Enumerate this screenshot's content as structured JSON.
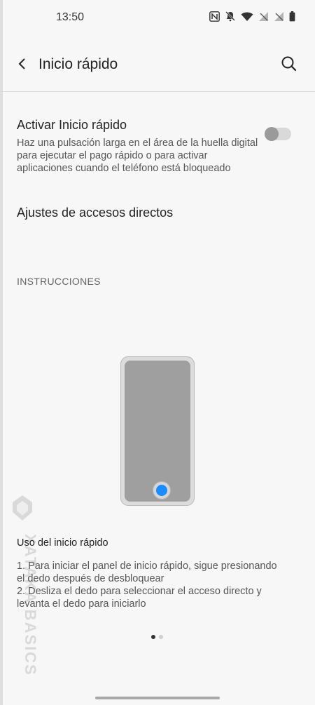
{
  "status_bar": {
    "time": "13:50",
    "icons": [
      "nfc-icon",
      "bell-muted-icon",
      "wifi-icon",
      "no-signal-icon",
      "no-signal-icon",
      "battery-icon"
    ]
  },
  "header": {
    "title": "Inicio rápido"
  },
  "quick_launch": {
    "title": "Activar Inicio rápido",
    "description": "Haz una pulsación larga en el área de la huella digital para ejecutar el pago rápido o para activar aplicaciones cuando el teléfono está bloqueado",
    "enabled": false
  },
  "shortcuts": {
    "label": "Ajustes de accesos directos"
  },
  "instructions": {
    "section_label": "INSTRUCCIONES",
    "title": "Uso del inicio rápido",
    "steps": "1. Para iniciar el panel de inicio rápido, sigue presionando el dedo después de desbloquear\n2. Desliza el dedo para seleccionar el acceso directo y levanta el dedo para iniciarlo",
    "page_index": 1,
    "page_count": 2
  },
  "watermark": {
    "text": "XATAKA BASICS"
  },
  "colors": {
    "accent": "#1a8cff",
    "background": "#f7f7f7"
  }
}
